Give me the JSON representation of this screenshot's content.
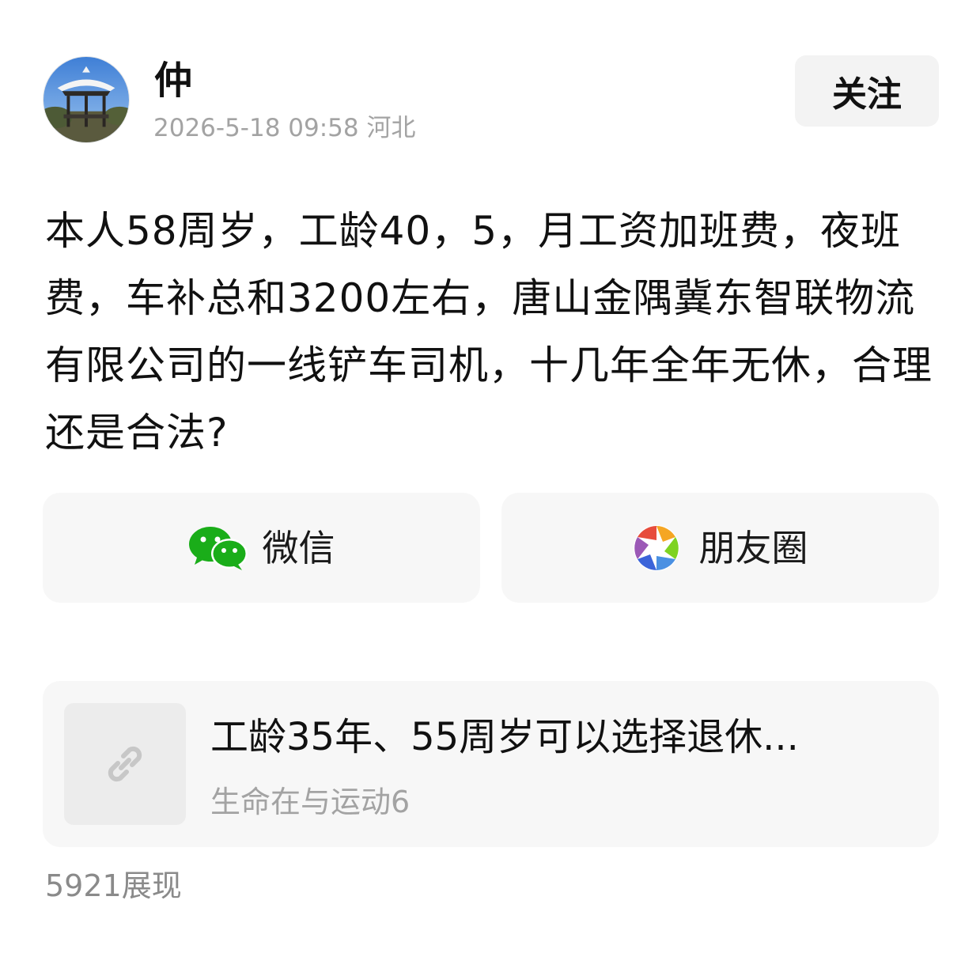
{
  "author": {
    "name": "仲",
    "meta": "2026-5-18 09:58 河北",
    "avatar_icon": "pavilion-photo"
  },
  "follow": {
    "label": "关注"
  },
  "post": {
    "text": "本人58周岁，工龄40，5，月工资加班费，夜班费，车补总和3200左右，唐山金隅冀东智联物流有限公司的一线铲车司机，十几年全年无休，合理还是合法?"
  },
  "share": {
    "wechat": {
      "label": "微信",
      "icon": "wechat-icon",
      "color": "#1aad19"
    },
    "moments": {
      "label": "朋友圈",
      "icon": "moments-icon"
    }
  },
  "linked_article": {
    "title": "工龄35年、55周岁可以选择退休...",
    "source": "生命在与运动6",
    "icon": "link-icon"
  },
  "stats": {
    "views": "5921展现"
  }
}
